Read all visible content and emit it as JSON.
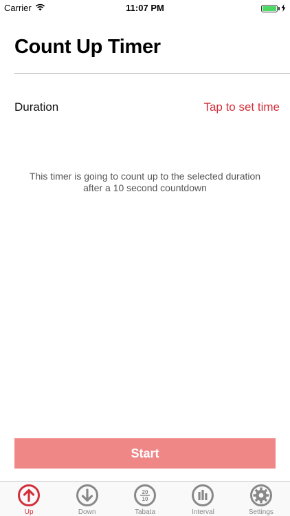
{
  "status_bar": {
    "carrier": "Carrier",
    "time": "11:07 PM",
    "icons": [
      "wifi-icon",
      "battery-icon",
      "charging-bolt-icon"
    ]
  },
  "header": {
    "title": "Count Up Timer"
  },
  "duration": {
    "label": "Duration",
    "value": "Tap to set time"
  },
  "description": {
    "line1": "This timer is going to count up to the selected duration",
    "line2": "after a 10 second countdown"
  },
  "actions": {
    "start_label": "Start"
  },
  "tabs": [
    {
      "label": "Up",
      "icon": "arrow-up-circle-icon",
      "active": true
    },
    {
      "label": "Down",
      "icon": "arrow-down-circle-icon",
      "active": false
    },
    {
      "label": "Tabata",
      "icon": "tabata-circle-icon",
      "active": false
    },
    {
      "label": "Interval",
      "icon": "bars-circle-icon",
      "active": false
    },
    {
      "label": "Settings",
      "icon": "gear-icon",
      "active": false
    }
  ],
  "tabata_icon_text": {
    "top": "20",
    "bottom": "10"
  },
  "colors": {
    "accent": "#d32f3a",
    "start_button": "#ef8787",
    "inactive_tab": "#888888",
    "battery": "#4cd964"
  }
}
